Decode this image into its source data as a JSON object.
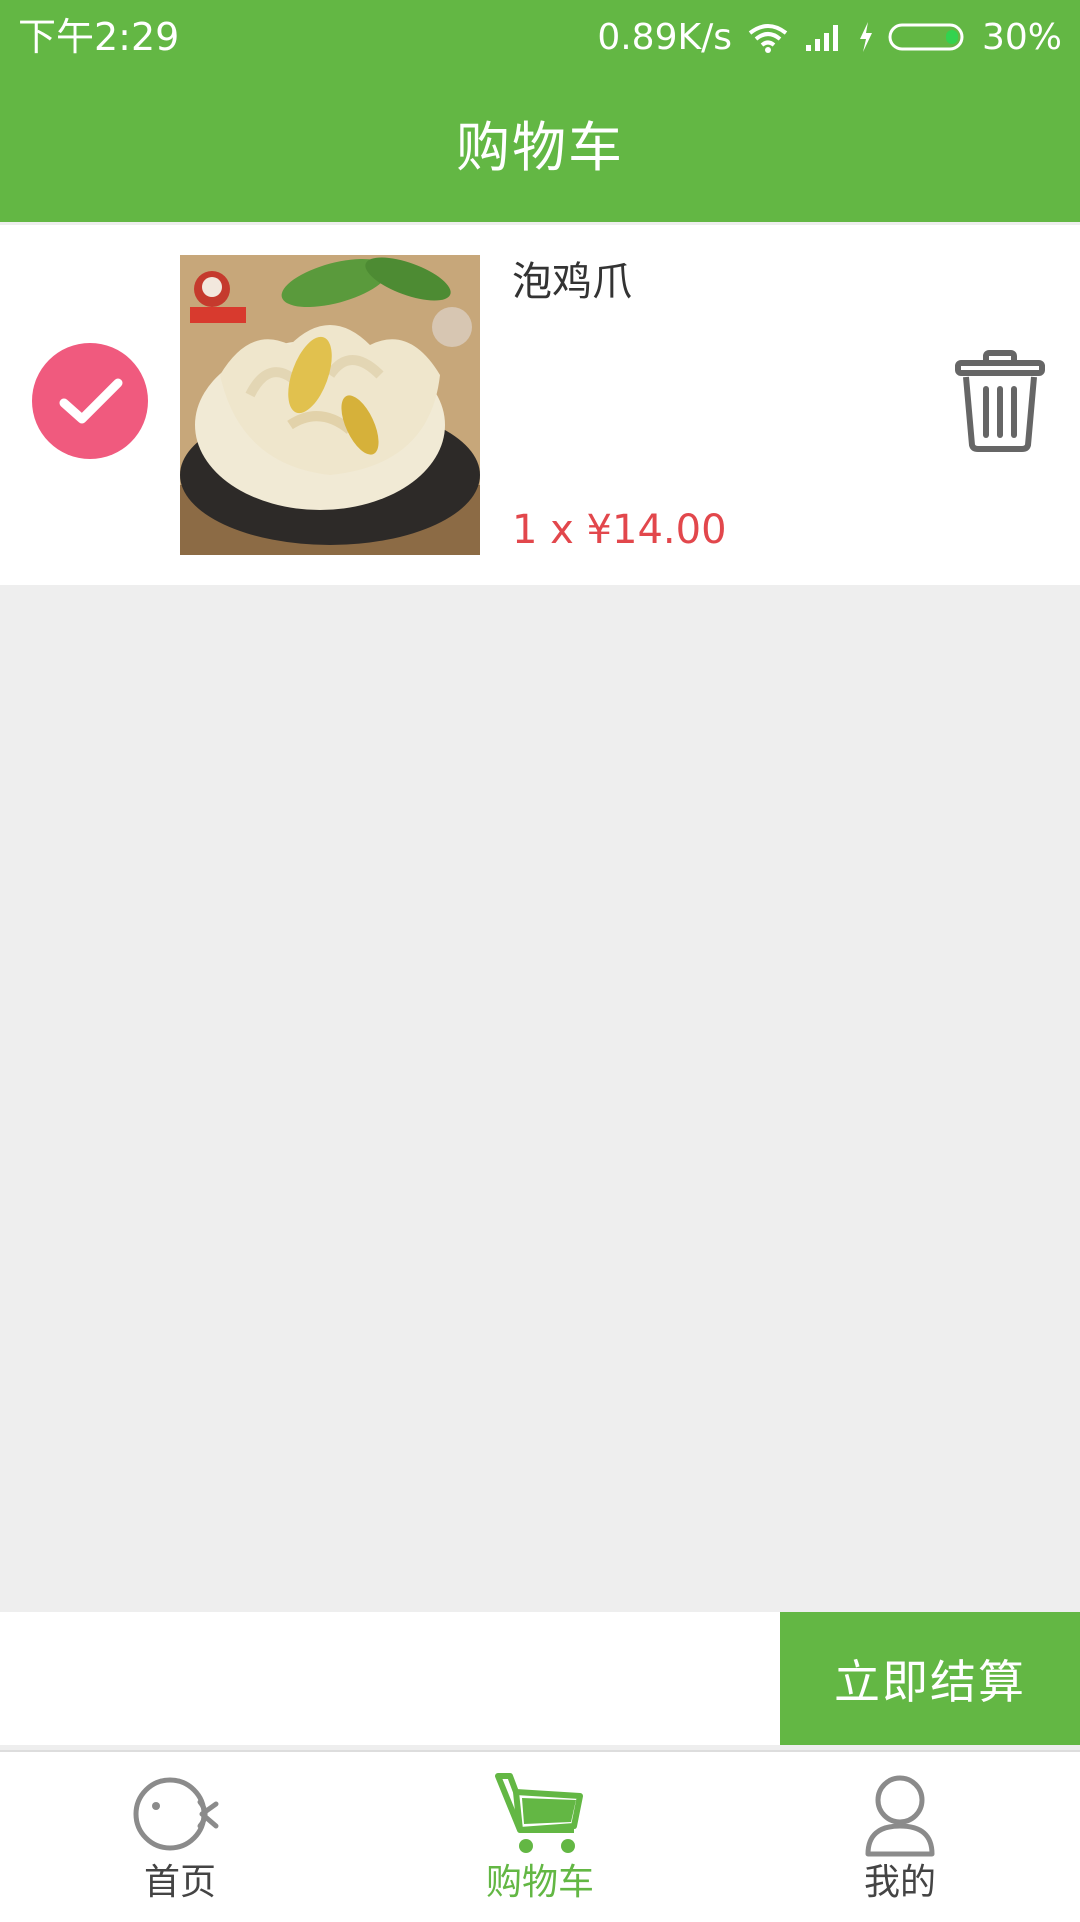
{
  "status_bar": {
    "time": "下午2:29",
    "network_speed": "0.89K/s",
    "battery": "30%"
  },
  "header": {
    "title": "购物车"
  },
  "cart": {
    "items": [
      {
        "name": "泡鸡爪",
        "price_line": "1 x ¥14.00",
        "checked": true
      }
    ]
  },
  "checkout": {
    "button_label": "立即结算"
  },
  "bottom_nav": {
    "items": [
      {
        "label": "首页",
        "icon": "home-icon"
      },
      {
        "label": "购物车",
        "icon": "cart-icon",
        "active": true
      },
      {
        "label": "我的",
        "icon": "profile-icon"
      }
    ]
  },
  "colors": {
    "primary_green": "#63b744",
    "check_pink": "#f05a7e",
    "price_red": "#e2474c"
  }
}
